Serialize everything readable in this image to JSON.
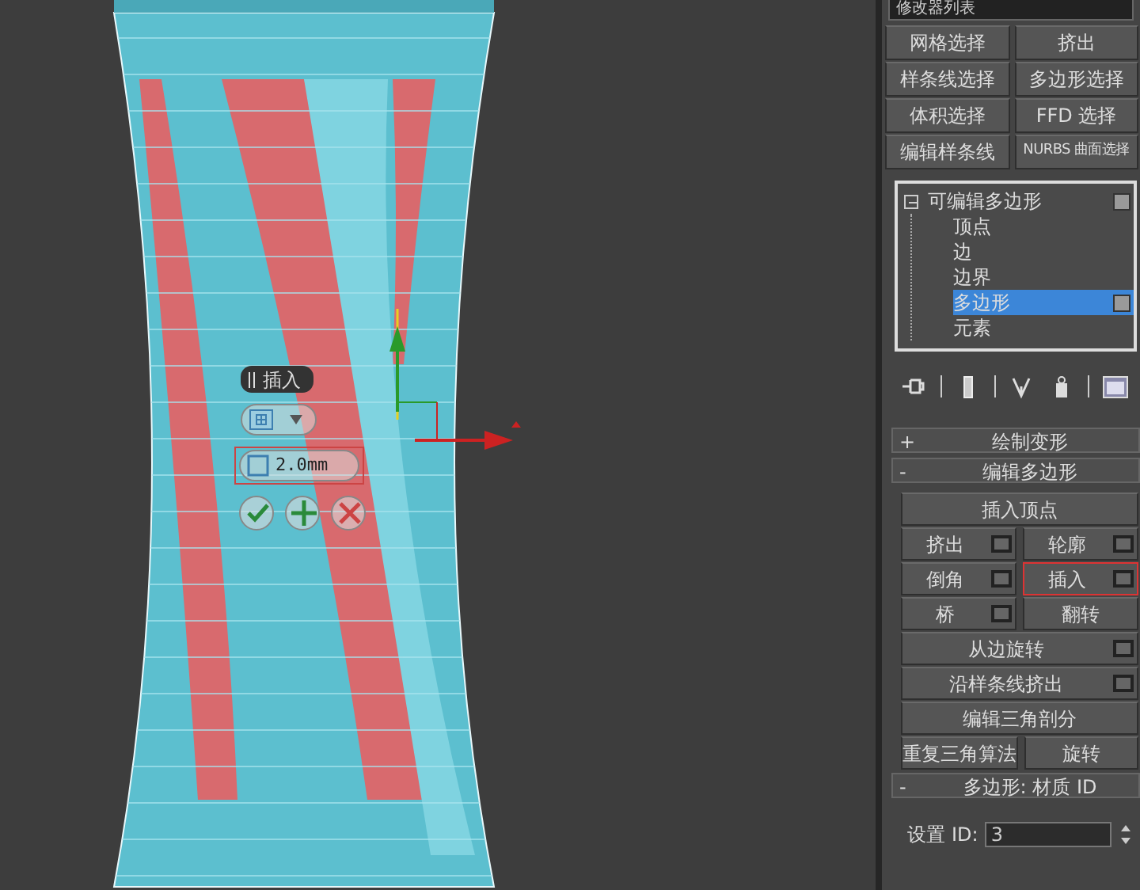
{
  "modifier_list": {
    "label": "修改器列表"
  },
  "modifier_buttons": [
    "网格选择",
    "挤出",
    "样条线选择",
    "多边形选择",
    "体积选择",
    "FFD 选择",
    "编辑样条线",
    "NURBS 曲面选择"
  ],
  "stack": [
    {
      "label": "可编辑多边形",
      "expanded": true,
      "selected": false,
      "children": [
        {
          "label": "顶点",
          "selected": false
        },
        {
          "label": "边",
          "selected": false
        },
        {
          "label": "边界",
          "selected": false
        },
        {
          "label": "多边形",
          "selected": true
        },
        {
          "label": "元素",
          "selected": false
        }
      ]
    }
  ],
  "rollouts": [
    {
      "sign": "+",
      "title": "绘制变形"
    },
    {
      "sign": "-",
      "title": "编辑多边形",
      "button_rows": [
        [
          {
            "label": "插入顶点",
            "settings": false,
            "active": false
          }
        ],
        [
          {
            "label": "挤出",
            "settings": true,
            "active": false
          },
          {
            "label": "轮廓",
            "settings": true,
            "active": false
          }
        ],
        [
          {
            "label": "倒角",
            "settings": true,
            "active": false
          },
          {
            "label": "插入",
            "settings": true,
            "active": true
          }
        ],
        [
          {
            "label": "桥",
            "settings": true,
            "active": false
          },
          {
            "label": "翻转",
            "settings": false,
            "active": false
          }
        ],
        [
          {
            "label": "从边旋转",
            "settings": true,
            "active": false
          }
        ],
        [
          {
            "label": "沿样条线挤出",
            "settings": true,
            "active": false
          }
        ],
        [
          {
            "label": "编辑三角剖分",
            "settings": false,
            "active": false
          }
        ],
        [
          {
            "label": "重复三角算法",
            "settings": false,
            "active": false
          },
          {
            "label": "旋转",
            "settings": false,
            "active": false
          }
        ]
      ]
    },
    {
      "sign": "-",
      "title": "多边形: 材质 ID",
      "fields": [
        {
          "label": "设置 ID:",
          "value": "3"
        }
      ]
    }
  ],
  "caddy": {
    "title": "插入",
    "amount": "2.0mm"
  }
}
